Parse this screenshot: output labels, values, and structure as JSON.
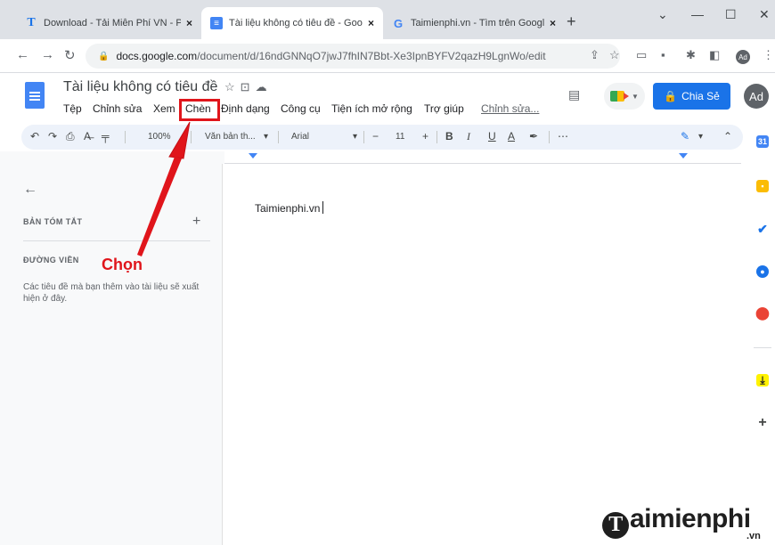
{
  "browser": {
    "tabs": [
      {
        "favicon": "T",
        "title": "Download - Tải Miễn Phí VN - Pl",
        "close": "×"
      },
      {
        "favicon": "≡",
        "title": "Tài liệu không có tiêu đề - Googl",
        "close": "×"
      },
      {
        "favicon": "G",
        "title": "Taimienphi.vn - Tìm trên Google",
        "close": "×"
      }
    ],
    "new_tab": "+",
    "window_controls": {
      "chevron": "⌄",
      "minimize": "—",
      "maximize": "☐",
      "close": "✕"
    },
    "url_domain": "docs.google.com",
    "url_path": "/document/d/16ndGNNqO7jwJ7fhIN7Bbt-Xe3IpnBYFV2qazH9LgnWo/edit",
    "profile": "Ad"
  },
  "docs": {
    "title": "Tài liệu không có tiêu đề",
    "menu": [
      "Tệp",
      "Chỉnh sửa",
      "Xem",
      "Chèn",
      "Định dạng",
      "Công cụ",
      "Tiện ích mở rộng",
      "Trợ giúp",
      "Chỉnh sửa..."
    ],
    "share_label": "Chia Sẻ",
    "avatar": "Ad",
    "toolbar": {
      "zoom": "100%",
      "style": "Văn bản th...",
      "font": "Arial",
      "font_size": "11",
      "minus": "−",
      "plus": "+",
      "bold": "B",
      "italic": "I",
      "underline": "U",
      "text_color": "A",
      "more": "⋯"
    },
    "outline": {
      "summary_label": "BẢN TÓM TẮT",
      "summary_add": "+",
      "outline_label": "ĐƯỜNG VIỀN",
      "hint": "Các tiêu đề mà bạn thêm vào tài liệu sẽ xuất hiện ở đây."
    },
    "body_text": "Taimienphi.vn",
    "side_add": "+"
  },
  "annotation": {
    "label": "Chọn",
    "color": "#e0151b"
  },
  "watermark": {
    "letter": "T",
    "text": "aimienphi",
    "suffix": ".vn"
  },
  "colors": {
    "accent": "#1a73e8",
    "annotation": "#e0151b",
    "toolbar_bg": "#edf2fa"
  }
}
